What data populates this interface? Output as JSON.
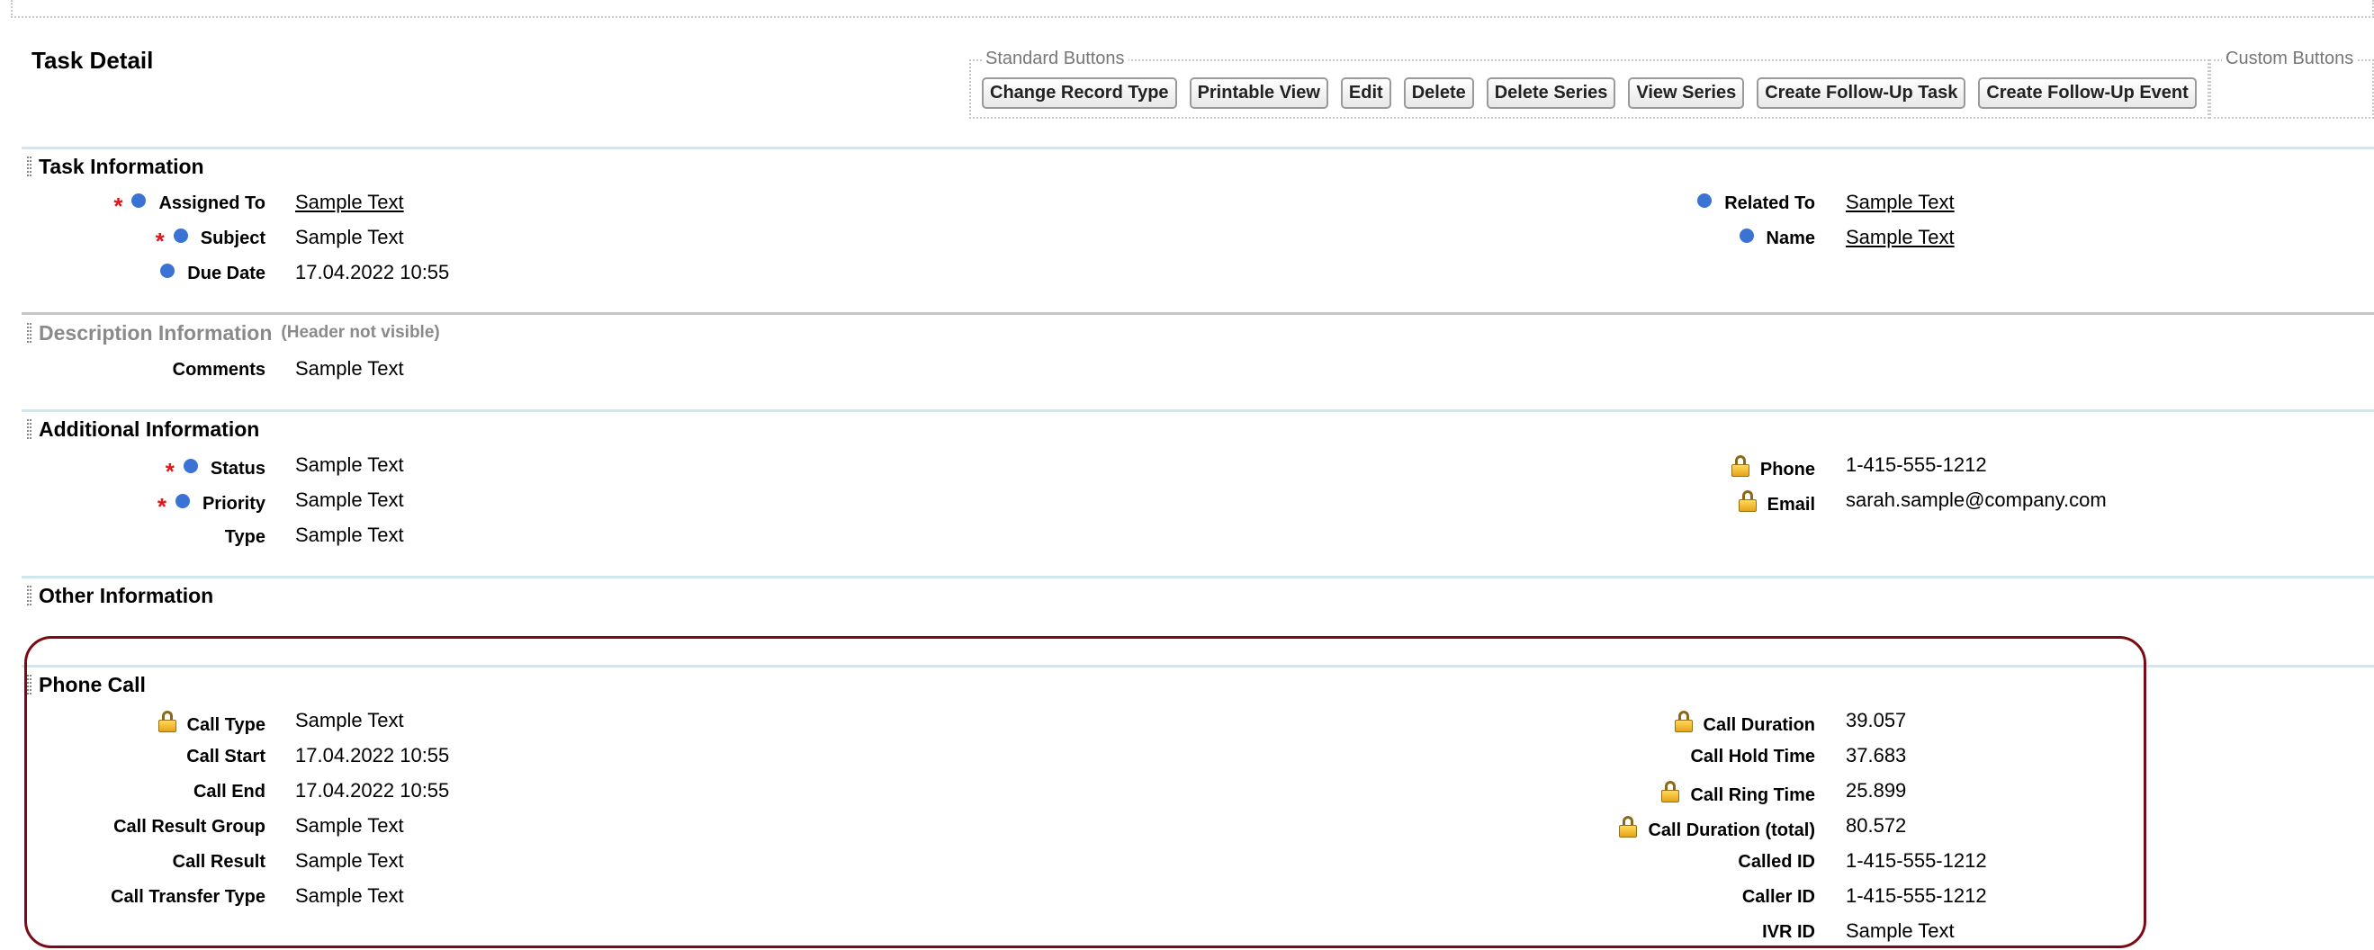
{
  "page_title": "Task Detail",
  "standard_buttons": {
    "legend": "Standard Buttons",
    "buttons": [
      "Change Record Type",
      "Printable View",
      "Edit",
      "Delete",
      "Delete Series",
      "View Series",
      "Create Follow-Up Task",
      "Create Follow-Up Event"
    ]
  },
  "custom_buttons": {
    "legend": "Custom Buttons"
  },
  "sections": {
    "task_information": {
      "title": "Task Information",
      "assigned_to": {
        "label": "Assigned To",
        "value": "Sample Text"
      },
      "subject": {
        "label": "Subject",
        "value": "Sample Text"
      },
      "due_date": {
        "label": "Due Date",
        "value": "17.04.2022 10:55"
      },
      "related_to": {
        "label": "Related To",
        "value": "Sample Text"
      },
      "name": {
        "label": "Name",
        "value": "Sample Text"
      }
    },
    "description_information": {
      "title": "Description Information",
      "hint": "(Header not visible)",
      "comments": {
        "label": "Comments",
        "value": "Sample Text"
      }
    },
    "additional_information": {
      "title": "Additional Information",
      "status": {
        "label": "Status",
        "value": "Sample Text"
      },
      "priority": {
        "label": "Priority",
        "value": "Sample Text"
      },
      "type": {
        "label": "Type",
        "value": "Sample Text"
      },
      "phone": {
        "label": "Phone",
        "value": "1-415-555-1212"
      },
      "email": {
        "label": "Email",
        "value": "sarah.sample@company.com"
      }
    },
    "other_information": {
      "title": "Other Information"
    },
    "phone_call": {
      "title": "Phone Call",
      "left": [
        {
          "label": "Call Type",
          "value": "Sample Text",
          "locked": true
        },
        {
          "label": "Call Start",
          "value": "17.04.2022 10:55"
        },
        {
          "label": "Call End",
          "value": "17.04.2022 10:55"
        },
        {
          "label": "Call Result Group",
          "value": "Sample Text"
        },
        {
          "label": "Call Result",
          "value": "Sample Text"
        },
        {
          "label": "Call Transfer Type",
          "value": "Sample Text"
        }
      ],
      "right": [
        {
          "label": "Call Duration",
          "value": "39.057",
          "locked": true
        },
        {
          "label": "Call Hold Time",
          "value": "37.683"
        },
        {
          "label": "Call Ring Time",
          "value": "25.899",
          "locked": true
        },
        {
          "label": "Call Duration (total)",
          "value": "80.572",
          "locked": true
        },
        {
          "label": "Called ID",
          "value": "1-415-555-1212"
        },
        {
          "label": "Caller ID",
          "value": "1-415-555-1212"
        },
        {
          "label": "IVR ID",
          "value": "Sample Text"
        }
      ]
    }
  },
  "colors": {
    "required": "#e0161c",
    "info_dot": "#3a73d4",
    "section_rule": "#cfe8f0",
    "highlight": "#7c0a14"
  }
}
